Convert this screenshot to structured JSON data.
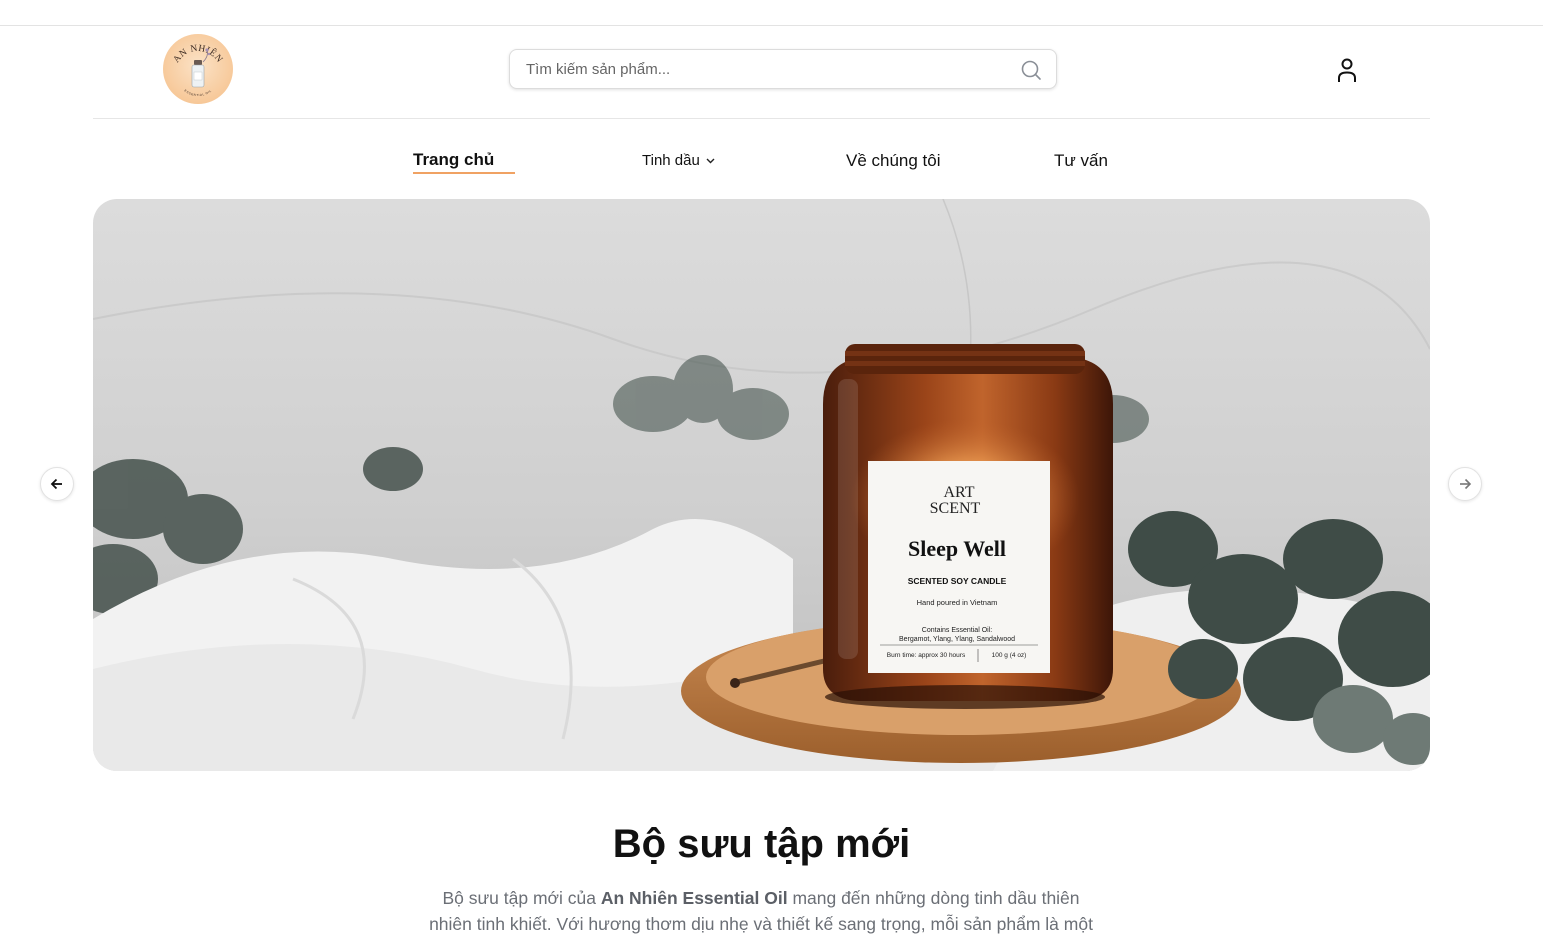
{
  "header": {
    "logo": {
      "text": "AN NHIÊN",
      "sub_text": "ESSENTIAL OIL",
      "icon": "essential-oil-bottle-icon"
    },
    "search": {
      "placeholder": "Tìm kiếm sản phẩm...",
      "value": "",
      "icon": "search-icon"
    },
    "user_icon": "user-icon"
  },
  "nav": {
    "items": [
      {
        "label": "Trang chủ",
        "active": true
      },
      {
        "label": "Tinh dầu",
        "dropdown": true,
        "icon": "chevron-down-icon"
      },
      {
        "label": "Về chúng tôi"
      },
      {
        "label": "Tư vấn"
      }
    ]
  },
  "hero": {
    "label": {
      "brand_line1": "ART",
      "brand_line2": "SCENT",
      "product_name": "Sleep Well",
      "product_type": "SCENTED SOY CANDLE",
      "origin": "Hand poured in Vietnam",
      "contains_title": "Contains Essential Oil:",
      "contains_list": "Bergamot, Ylang, Ylang, Sandalwood",
      "burn_time": "Burn time: approx 30 hours",
      "weight": "100 g (4 oz)"
    },
    "prev_icon": "arrow-left-icon",
    "next_icon": "arrow-right-icon"
  },
  "section": {
    "title": "Bộ sưu tập mới",
    "desc_before": "Bộ sưu tập mới của ",
    "desc_brand": "An Nhiên Essential Oil",
    "desc_after": " mang đến những dòng tinh dầu thiên nhiên tinh khiết. Với hương thơm dịu nhẹ và thiết kế sang trọng, mỗi sản phẩm là một"
  },
  "colors": {
    "accent": "#f0a263",
    "logo_bg": "#f7c99a",
    "candle_amber": "#8a3a14",
    "text_muted": "#6b6f76"
  }
}
